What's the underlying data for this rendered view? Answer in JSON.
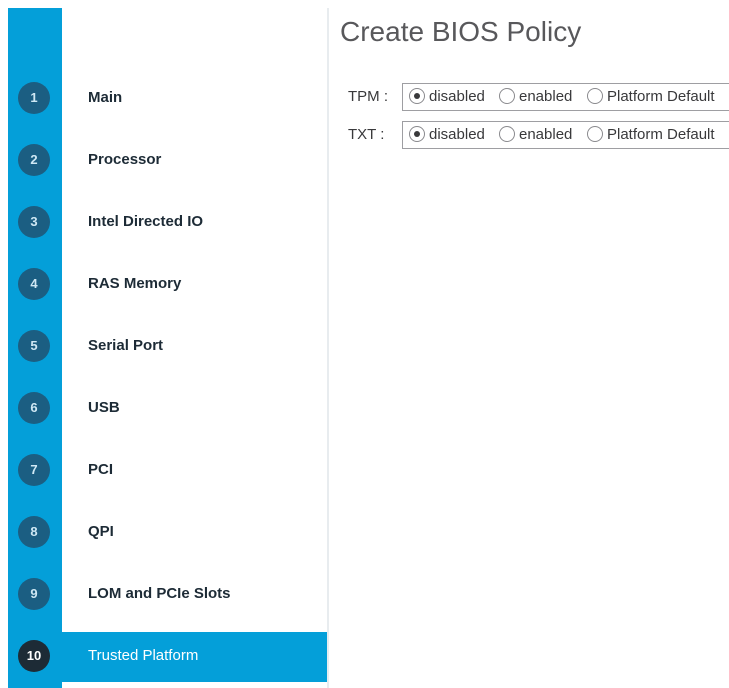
{
  "page": {
    "title": "Create BIOS Policy"
  },
  "wizard": {
    "accent_color": "#049fd9",
    "active_step": 10,
    "steps": [
      {
        "num": "1",
        "label": "Main"
      },
      {
        "num": "2",
        "label": "Processor"
      },
      {
        "num": "3",
        "label": "Intel Directed IO"
      },
      {
        "num": "4",
        "label": "RAS Memory"
      },
      {
        "num": "5",
        "label": "Serial Port"
      },
      {
        "num": "6",
        "label": "USB"
      },
      {
        "num": "7",
        "label": "PCI"
      },
      {
        "num": "8",
        "label": "QPI"
      },
      {
        "num": "9",
        "label": "LOM and PCIe Slots"
      },
      {
        "num": "10",
        "label": "Trusted Platform"
      }
    ]
  },
  "form": {
    "fields": [
      {
        "label": "TPM :",
        "selected": "disabled",
        "options": [
          "disabled",
          "enabled",
          "Platform Default"
        ]
      },
      {
        "label": "TXT :",
        "selected": "disabled",
        "options": [
          "disabled",
          "enabled",
          "Platform Default"
        ]
      }
    ]
  }
}
